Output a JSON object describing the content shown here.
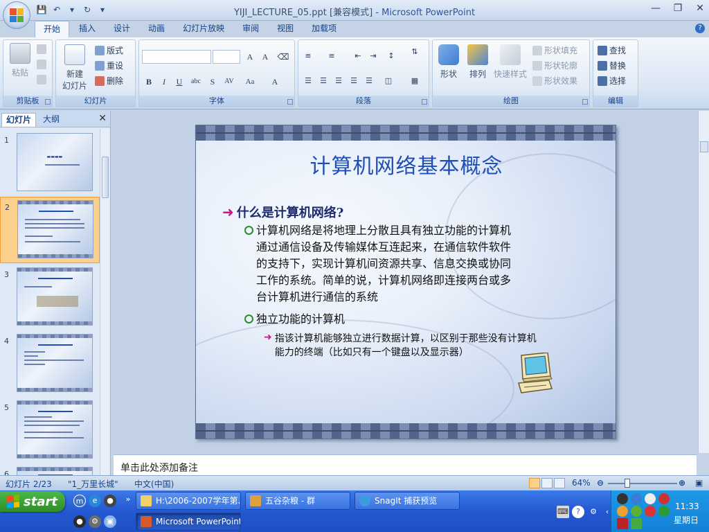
{
  "window": {
    "title_file": "YIJI_LECTURE_05.ppt [兼容模式]",
    "title_sep": "-",
    "title_app": "Microsoft PowerPoint"
  },
  "ribbon": {
    "tabs": [
      "开始",
      "插入",
      "设计",
      "动画",
      "幻灯片放映",
      "审阅",
      "视图",
      "加载项"
    ],
    "clipboard": {
      "label": "剪贴板",
      "paste": "粘贴"
    },
    "slides": {
      "label": "幻灯片",
      "new_slide_1": "新建",
      "new_slide_2": "幻灯片",
      "layout": "版式",
      "reset": "重设",
      "delete": "删除"
    },
    "font": {
      "label": "字体"
    },
    "paragraph": {
      "label": "段落"
    },
    "drawing": {
      "label": "绘图",
      "shape": "形状",
      "arrange": "排列",
      "quick_styles": "快速样式",
      "fill": "形状填充",
      "outline": "形状轮廓",
      "effects": "形状效果"
    },
    "editing": {
      "label": "编辑",
      "find": "查找",
      "replace": "替换",
      "select": "选择"
    }
  },
  "left_panel": {
    "tab_slides": "幻灯片",
    "tab_outline": "大纲",
    "thumbnails": [
      {
        "num": "1"
      },
      {
        "num": "2"
      },
      {
        "num": "3"
      },
      {
        "num": "4"
      },
      {
        "num": "5"
      },
      {
        "num": "6"
      }
    ]
  },
  "slide": {
    "title": "计算机网络基本概念",
    "heading": "什么是计算机网络?",
    "bullet1": [
      "计算机网络是将地理上分散且具有独立功能的计算机",
      "通过通信设备及传输媒体互连起来，在通信软件软件",
      "的支持下，实现计算机间资源共享、信息交换或协同",
      "工作的系统。简单的说，计算机网络即连接两台或多",
      "台计算机进行通信的系统"
    ],
    "bullet2": "独立功能的计算机",
    "sub_bullet": [
      "指该计算机能够独立进行数据计算，以区别于那些没有计算机",
      "能力的终端（比如只有一个键盘以及显示器）"
    ]
  },
  "notes": {
    "placeholder": "单击此处添加备注"
  },
  "status": {
    "slide_pos": "幻灯片 2/23",
    "theme": "\"1_万里长城\"",
    "language": "中文(中国)",
    "zoom": "64%"
  },
  "taskbar": {
    "start": "start",
    "tasks": [
      "H:\\2006-2007学年第...",
      "五谷杂粮 - 群",
      "SnagIt 捕获预览",
      "Microsoft PowerPoint..."
    ],
    "clock_time": "11:33",
    "clock_day": "星期日"
  },
  "colors": {
    "accent": "#1f4fb5",
    "bullet_green": "#2a8c2a",
    "arrow_magenta": "#c8168a",
    "taskbar_blue": "#2458d1",
    "start_green": "#3aa335"
  }
}
